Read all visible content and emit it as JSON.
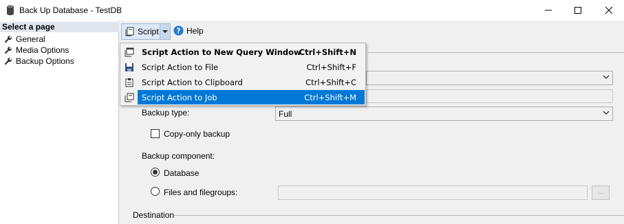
{
  "window": {
    "title": "Back Up Database - TestDB",
    "controls": [
      "minimize",
      "maximize",
      "close"
    ]
  },
  "left_pane": {
    "header": "Select a page",
    "items": [
      {
        "label": "General",
        "icon": "wrench-icon"
      },
      {
        "label": "Media Options",
        "icon": "wrench-icon"
      },
      {
        "label": "Backup Options",
        "icon": "wrench-icon"
      }
    ]
  },
  "toolbar": {
    "script_label": "Script",
    "help_label": "Help"
  },
  "script_menu": {
    "items": [
      {
        "label": "Script Action to New Query Window",
        "shortcut": "Ctrl+Shift+N",
        "bold": true,
        "selected": false
      },
      {
        "label": "Script Action to File",
        "shortcut": "Ctrl+Shift+F",
        "bold": false,
        "selected": false
      },
      {
        "label": "Script Action to Clipboard",
        "shortcut": "Ctrl+Shift+C",
        "bold": false,
        "selected": false
      },
      {
        "label": "Script Action to Job",
        "shortcut": "Ctrl+Shift+M",
        "bold": false,
        "selected": true
      }
    ]
  },
  "form": {
    "backup_type_label": "Backup type:",
    "backup_type_value": "Full",
    "copy_only_label": "Copy-only backup",
    "copy_only_checked": false,
    "backup_component_label": "Backup component:",
    "database_label": "Database",
    "database_selected": true,
    "files_label": "Files and filegroups:",
    "files_selected": false,
    "browse_label": "...",
    "destination_label": "Destination"
  },
  "colors": {
    "selection": "#0078d7",
    "header_bg": "#dfe6ee",
    "help_icon": "#1e7bd8"
  }
}
